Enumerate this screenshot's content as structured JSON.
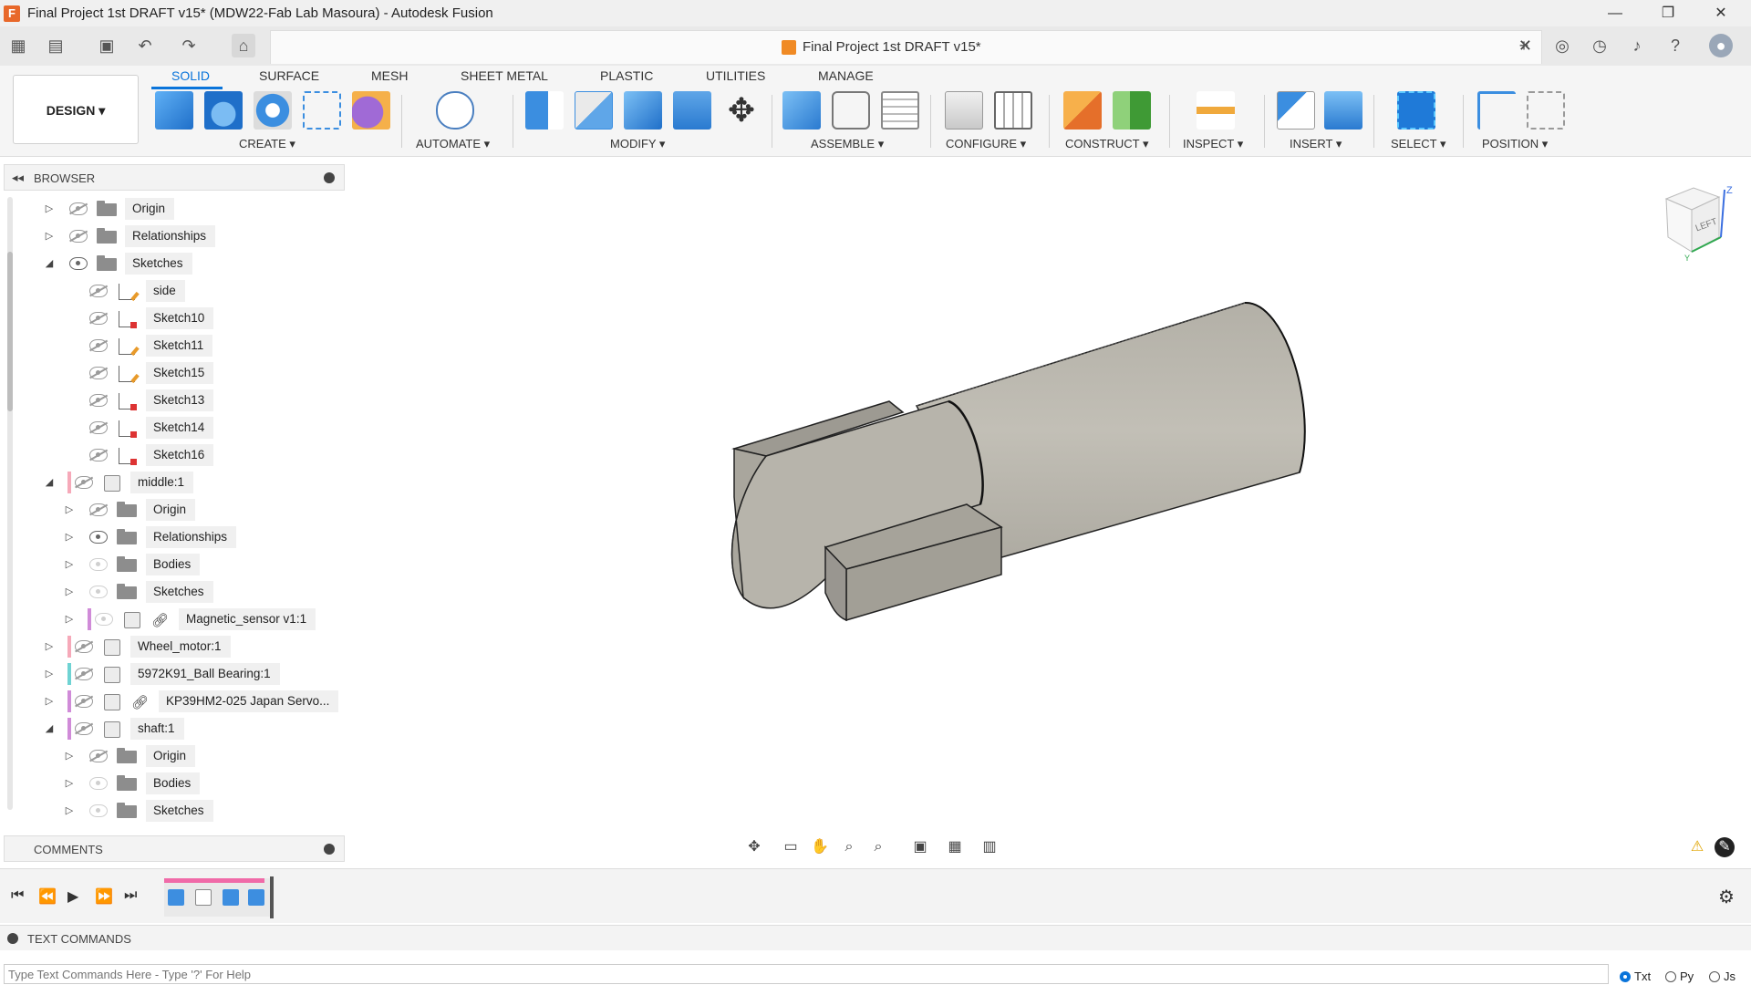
{
  "window": {
    "title": "Final Project 1st DRAFT v15* (MDW22-Fab Lab Masoura) - Autodesk Fusion",
    "minimize_label": "—",
    "maximize_label": "❐",
    "close_label": "✕"
  },
  "document_tab": {
    "title": "Final Project 1st DRAFT v15*",
    "close_label": "✕"
  },
  "ribbon": {
    "workspace_label": "DESIGN ▾",
    "tabs": [
      {
        "label": "SOLID"
      },
      {
        "label": "SURFACE"
      },
      {
        "label": "MESH"
      },
      {
        "label": "SHEET METAL"
      },
      {
        "label": "PLASTIC"
      },
      {
        "label": "UTILITIES"
      },
      {
        "label": "MANAGE"
      }
    ],
    "groups": [
      {
        "label": "CREATE ▾"
      },
      {
        "label": "AUTOMATE ▾"
      },
      {
        "label": "MODIFY ▾"
      },
      {
        "label": "ASSEMBLE ▾"
      },
      {
        "label": "CONFIGURE ▾"
      },
      {
        "label": "CONSTRUCT ▾"
      },
      {
        "label": "INSPECT ▾"
      },
      {
        "label": "INSERT ▾"
      },
      {
        "label": "SELECT ▾"
      },
      {
        "label": "POSITION ▾"
      }
    ]
  },
  "browser": {
    "title": "BROWSER",
    "items": [
      {
        "label": "Origin"
      },
      {
        "label": "Relationships"
      },
      {
        "label": "Sketches"
      },
      {
        "label": "side"
      },
      {
        "label": "Sketch10"
      },
      {
        "label": "Sketch11"
      },
      {
        "label": "Sketch15"
      },
      {
        "label": "Sketch13"
      },
      {
        "label": "Sketch14"
      },
      {
        "label": "Sketch16"
      },
      {
        "label": "middle:1"
      },
      {
        "label": "Origin"
      },
      {
        "label": "Relationships"
      },
      {
        "label": "Bodies"
      },
      {
        "label": "Sketches"
      },
      {
        "label": "Magnetic_sensor v1:1"
      },
      {
        "label": "Wheel_motor:1"
      },
      {
        "label": "5972K91_Ball Bearing:1"
      },
      {
        "label": "KP39HM2-025 Japan Servo..."
      },
      {
        "label": "shaft:1"
      },
      {
        "label": "Origin"
      },
      {
        "label": "Bodies"
      },
      {
        "label": "Sketches"
      }
    ]
  },
  "viewcube": {
    "face_label": "LEFT"
  },
  "comments": {
    "title": "COMMENTS"
  },
  "text_commands": {
    "title": "TEXT COMMANDS",
    "placeholder": "Type Text Commands Here - Type '?' For Help",
    "modes": [
      {
        "label": "Txt"
      },
      {
        "label": "Py"
      },
      {
        "label": "Js"
      }
    ]
  },
  "colors": {
    "accent": "#0a74da",
    "model_body": "#b9b6ad",
    "timeline_pink": "#f06aa8"
  }
}
